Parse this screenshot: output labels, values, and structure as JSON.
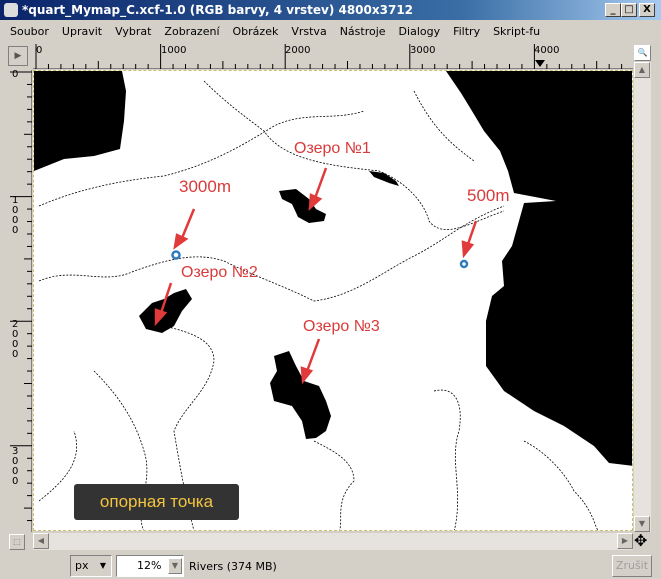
{
  "window": {
    "title": "*quart_Mymap_C.xcf-1.0 (RGB barvy, 4 vrstev) 4800x3712",
    "minimize": "_",
    "maximize": "□",
    "close": "X"
  },
  "menu": [
    "Soubor",
    "Upravit",
    "Vybrat",
    "Zobrazení",
    "Obrázek",
    "Vrstva",
    "Nástroje",
    "Dialogy",
    "Filtry",
    "Skript-fu"
  ],
  "ruler_top": [
    "0",
    "1000",
    "2000",
    "3000",
    "4000"
  ],
  "ruler_left": [
    "0",
    "1000",
    "2000",
    "3000"
  ],
  "annotations": {
    "lake1": "Озеро №1",
    "lake2": "Озеро №2",
    "lake3": "Озеро №3",
    "alt1": "3000m",
    "alt2": "500m",
    "reference": "опорная точка"
  },
  "colors": {
    "annotation": "#d93a3a",
    "marker": "#2e7bbf",
    "ref_text": "#f3c440"
  },
  "status": {
    "unit": "px",
    "zoom": "12%",
    "info": "Rivers (374 MB)",
    "cancel": "Zrušit"
  }
}
